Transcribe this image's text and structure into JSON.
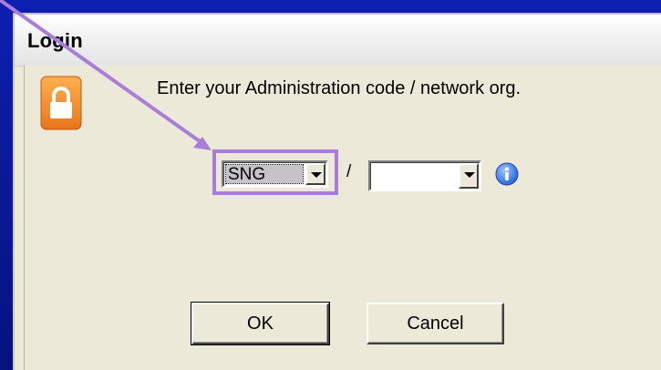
{
  "dialog": {
    "title": "Login",
    "prompt": "Enter your Administration code / network org."
  },
  "admin_code_combo": {
    "value": "SNG"
  },
  "separator": "/",
  "network_org_combo": {
    "value": ""
  },
  "buttons": {
    "ok": "OK",
    "cancel": "Cancel"
  },
  "colors": {
    "background": "#0a1a9a",
    "highlight": "#a87ed8",
    "arrow": "#a87ed8",
    "lock_icon": "#f0902a",
    "info_icon": "#2a6ee0"
  },
  "icons": {
    "lock": "lock-icon",
    "info": "info-icon"
  }
}
